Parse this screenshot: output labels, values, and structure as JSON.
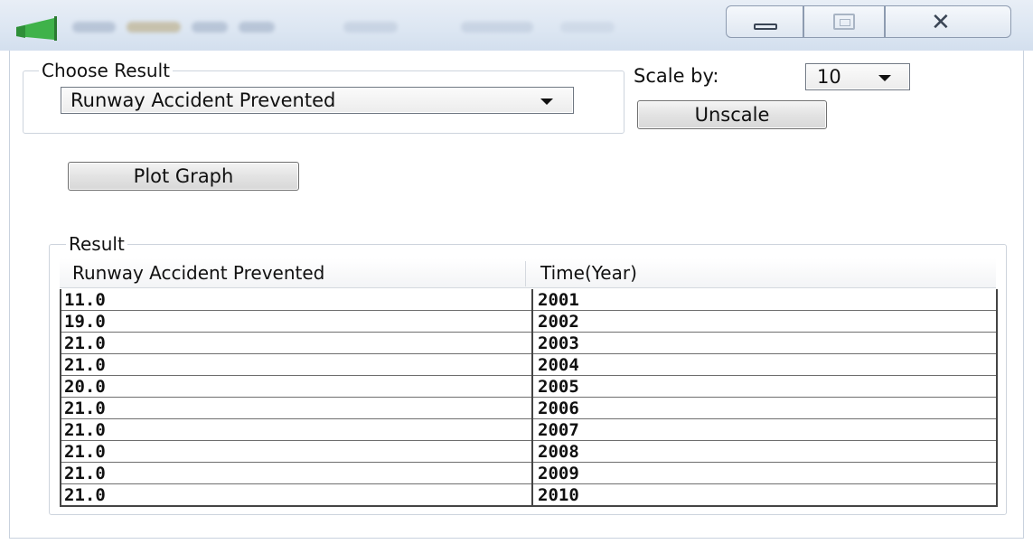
{
  "window": {
    "icon": "green-flag-icon",
    "controls": {
      "minimize": "minimize-icon",
      "maximize": "maximize-icon",
      "close": "close-icon"
    },
    "close_glyph": "✕"
  },
  "choose_result": {
    "group_title": "Choose Result",
    "selected": "Runway Accident Prevented"
  },
  "scale": {
    "label": "Scale by:",
    "value": "10",
    "unscale_label": "Unscale"
  },
  "plot_button": "Plot Graph",
  "result": {
    "group_title": "Result",
    "columns": [
      "Runway Accident Prevented",
      "Time(Year)"
    ],
    "rows": [
      [
        "11.0",
        "2001"
      ],
      [
        "19.0",
        "2002"
      ],
      [
        "21.0",
        "2003"
      ],
      [
        "21.0",
        "2004"
      ],
      [
        "20.0",
        "2005"
      ],
      [
        "21.0",
        "2006"
      ],
      [
        "21.0",
        "2007"
      ],
      [
        "21.0",
        "2008"
      ],
      [
        "21.0",
        "2009"
      ],
      [
        "21.0",
        "2010"
      ]
    ]
  }
}
